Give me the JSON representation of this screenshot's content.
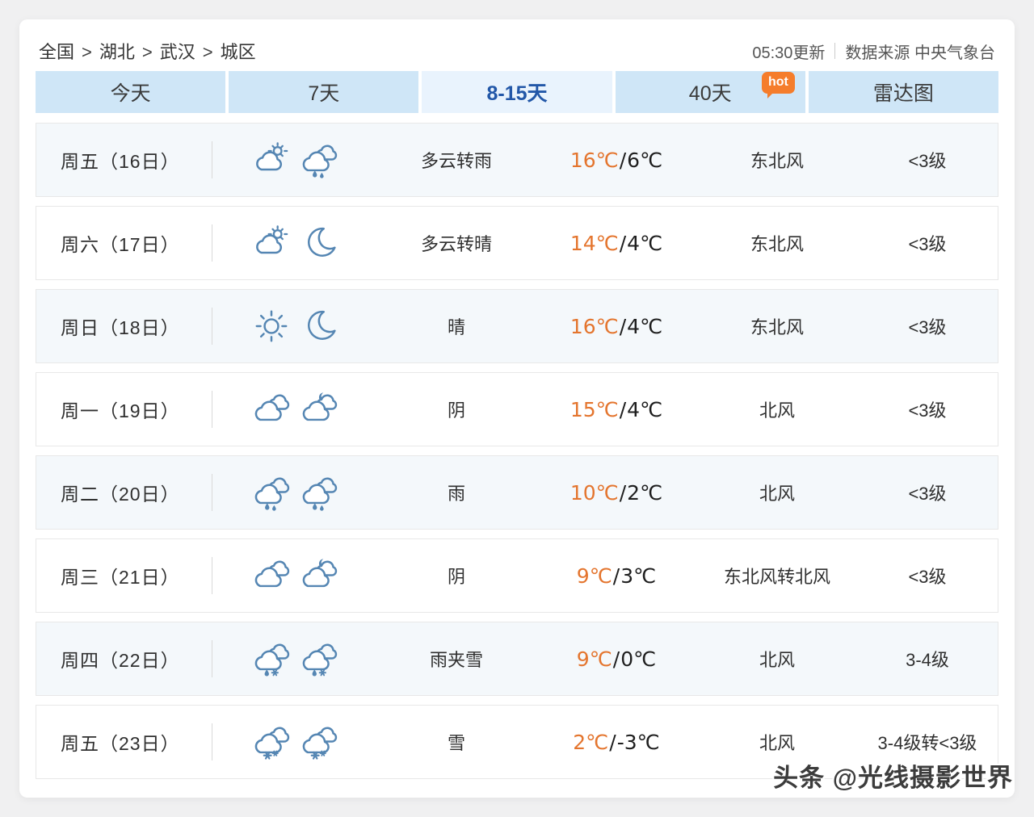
{
  "breadcrumb": {
    "items": [
      "全国",
      "湖北",
      "武汉",
      "城区"
    ],
    "separator": ">"
  },
  "meta": {
    "updated": "05:30更新",
    "source": "数据来源 中央气象台"
  },
  "tabs": [
    {
      "name": "today",
      "label": "今天",
      "active": false
    },
    {
      "name": "7-days",
      "label": "7天",
      "active": false
    },
    {
      "name": "8-15-days",
      "label": "8-15天",
      "active": true
    },
    {
      "name": "40-days",
      "label": "40天",
      "active": false,
      "badge": "hot"
    },
    {
      "name": "radar",
      "label": "雷达图",
      "active": false
    }
  ],
  "forecast": {
    "rows": [
      {
        "day": "周五（16日）",
        "icons": [
          "cloud-sun",
          "rain"
        ],
        "weather": "多云转雨",
        "temp_high": "16℃",
        "temp_low": "6℃",
        "wind": "东北风",
        "wind_scale": "<3级"
      },
      {
        "day": "周六（17日）",
        "icons": [
          "cloud-sun",
          "moon"
        ],
        "weather": "多云转晴",
        "temp_high": "14℃",
        "temp_low": "4℃",
        "wind": "东北风",
        "wind_scale": "<3级"
      },
      {
        "day": "周日（18日）",
        "icons": [
          "sun",
          "moon"
        ],
        "weather": "晴",
        "temp_high": "16℃",
        "temp_low": "4℃",
        "wind": "东北风",
        "wind_scale": "<3级"
      },
      {
        "day": "周一（19日）",
        "icons": [
          "overcast",
          "overcast-night"
        ],
        "weather": "阴",
        "temp_high": "15℃",
        "temp_low": "4℃",
        "wind": "北风",
        "wind_scale": "<3级"
      },
      {
        "day": "周二（20日）",
        "icons": [
          "rain",
          "rain"
        ],
        "weather": "雨",
        "temp_high": "10℃",
        "temp_low": "2℃",
        "wind": "北风",
        "wind_scale": "<3级"
      },
      {
        "day": "周三（21日）",
        "icons": [
          "overcast",
          "overcast-night"
        ],
        "weather": "阴",
        "temp_high": "9℃",
        "temp_low": "3℃",
        "wind": "东北风转北风",
        "wind_scale": "<3级"
      },
      {
        "day": "周四（22日）",
        "icons": [
          "sleet",
          "sleet"
        ],
        "weather": "雨夹雪",
        "temp_high": "9℃",
        "temp_low": "0℃",
        "wind": "北风",
        "wind_scale": "3-4级"
      },
      {
        "day": "周五（23日）",
        "icons": [
          "snow",
          "snow"
        ],
        "weather": "雪",
        "temp_high": "2℃",
        "temp_low": "-3℃",
        "wind": "北风",
        "wind_scale": "3-4级转<3级"
      }
    ]
  },
  "watermark": "头条 @光线摄影世界",
  "colors": {
    "tab_bg": "#cfe6f7",
    "tab_active_bg": "#e9f3fd",
    "tab_active_text": "#2257a8",
    "temp_high": "#e4752e",
    "icon_blue": "#5586b3",
    "badge_orange": "#f57d2c",
    "row_alt_bg": "#f4f8fb"
  }
}
